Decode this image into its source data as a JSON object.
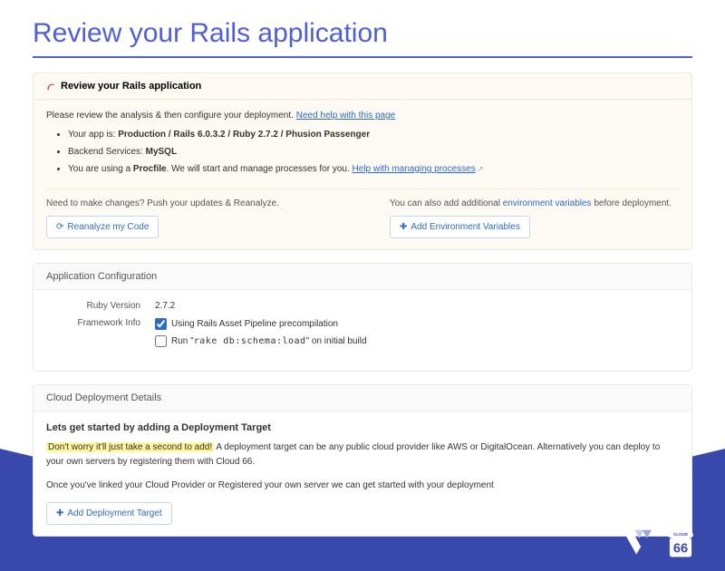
{
  "pageTitle": "Review your Rails application",
  "reviewPanel": {
    "header": "Review your Rails application",
    "introPrefix": "Please review the analysis & then configure your deployment. ",
    "helpLink": "Need help with this page",
    "bullets": {
      "appInfoPrefix": "Your app is: ",
      "appInfoValue": "Production / Rails 6.0.3.2 / Ruby 2.7.2 / Phusion Passenger",
      "backendPrefix": "Backend Services: ",
      "backendValue": "MySQL",
      "procPrefix": "You are using a ",
      "procBold": "Procfile",
      "procSuffix": ". We will start and manage processes for you. ",
      "procLink": "Help with managing processes"
    },
    "actions": {
      "reanalyzeLabel": "Need to make changes? Push your updates & Reanalyze.",
      "reanalyzeBtn": "Reanalyze my Code",
      "envPrefix": "You can also add additional ",
      "envLink": "environment variables",
      "envSuffix": " before deployment.",
      "envBtn": "Add Environment Variables"
    }
  },
  "configPanel": {
    "header": "Application Configuration",
    "rubyLabel": "Ruby Version",
    "rubyValue": "2.7.2",
    "frameworkLabel": "Framework Info",
    "checkbox1": "Using Rails Asset Pipeline precompilation",
    "checkbox2Prefix": "Run \"",
    "checkbox2Code": "rake db:schema:load",
    "checkbox2Suffix": "\" on initial build"
  },
  "deployPanel": {
    "header": "Cloud Deployment Details",
    "startHeader": "Lets get started by adding a Deployment Target",
    "highlight": "Don't worry it'll just take a second to add!",
    "line1": " A deployment target can be any public cloud provider like AWS or DigitalOcean. Alternatively you can deploy to your own servers by registering them with Cloud 66.",
    "line2": "Once you've linked your Cloud Provider or Registered your own server we can get started with your deployment",
    "addBtn": "Add Deployment Target"
  },
  "logos": {
    "cloud66Text": "CLOUD",
    "cloud66Num": "66"
  }
}
